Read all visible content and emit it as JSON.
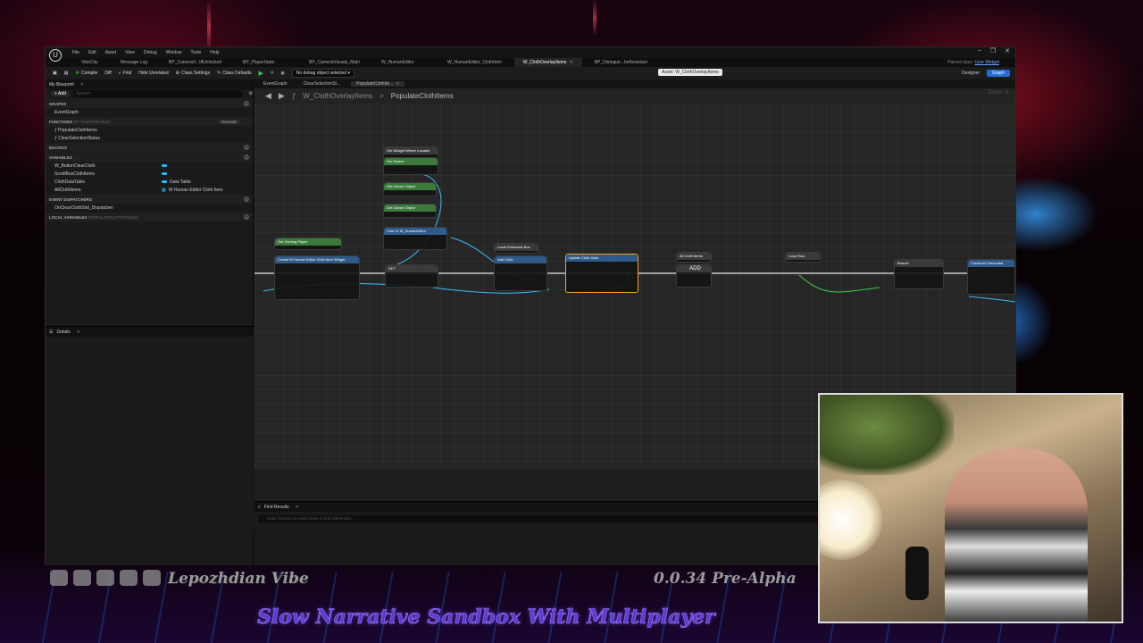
{
  "window": {
    "menu": [
      "File",
      "Edit",
      "Asset",
      "View",
      "Debug",
      "Window",
      "Tools",
      "Help"
    ],
    "controls": [
      "–",
      "❐",
      "✕"
    ],
    "project_tab": "VibeCity",
    "message_log": "Message Log",
    "tabs": [
      "BP_CameraV...tifUnlocked",
      "BP_PlayerState",
      "BP_CameraVisuals_Main",
      "W_HumanEditor",
      "W_HumanEditor_ClothItem",
      "W_ClothOverlayItems",
      "BP_Dialogue...beAssistant"
    ],
    "active_tab_index": 5,
    "parent_class_label": "Parent class:",
    "parent_class_value": "User Widget",
    "tooltip": "Asset: W_ClothOverlayItems"
  },
  "toolbar": {
    "compile": "Compile",
    "diff": "Diff",
    "find": "Find",
    "hide_unrelated": "Hide Unrelated",
    "class_settings": "Class Settings",
    "class_defaults": "Class Defaults",
    "debug_object": "No debug object selected",
    "designer": "Designer",
    "graph": "Graph"
  },
  "my_blueprint": {
    "title": "My Blueprint",
    "add": "+ Add",
    "search_placeholder": "Search",
    "sections": {
      "graphs": "GRAPHS",
      "functions": "FUNCTIONS",
      "functions_count": "(27 OVERRIDABLE)",
      "override": "Override",
      "macros": "MACROS",
      "variables": "VARIABLES",
      "event_dispatchers": "EVENT DISPATCHERS",
      "local_variables": "LOCAL VARIABLES",
      "local_variables_scope": "(POPULATECLOTHITEMS)"
    },
    "graphs": [
      "EventGraph"
    ],
    "functions": [
      "PopulateClothItems",
      "ClearSelectionStatus"
    ],
    "variables": [
      {
        "name": "W_ButtonClearCloth",
        "type": ""
      },
      {
        "name": "ScrollBoxClothItems",
        "type": ""
      },
      {
        "name": "ClothDataTable",
        "type": "Data Table"
      },
      {
        "name": "AllClothItems",
        "type": "W Human Editor Cloth Item"
      }
    ],
    "event_dispatchers": [
      "OnClearClothSlot_Dispatcher"
    ]
  },
  "details": {
    "title": "Details"
  },
  "graph": {
    "tabs": [
      "EventGraph",
      "ClearSelectionSt...",
      "PopulateClothIte..."
    ],
    "breadcrumb_root": "W_ClothOverlayItems",
    "breadcrumb_sep": ">",
    "breadcrumb_current": "PopulateClothItems",
    "zoom": "Zoom -3",
    "nodes": [
      {
        "id": "get-widgets",
        "title": "Get Widget Where Located",
        "color": "#3a3a3a"
      },
      {
        "id": "get-parent",
        "title": "Get Parent",
        "color": "#3c7a3c"
      },
      {
        "id": "get-owner-1",
        "title": "Get Owner Object",
        "color": "#3c7a3c"
      },
      {
        "id": "get-owner-2",
        "title": "Get Owner Object",
        "color": "#3c7a3c"
      },
      {
        "id": "cast",
        "title": "Cast To W_HumanEditor",
        "color": "#2f5b8a"
      },
      {
        "id": "get-owning-player",
        "title": "Get Owning Player",
        "color": "#3c7a3c"
      },
      {
        "id": "create-widget",
        "title": "Create W Human Editor Cloth Item Widget",
        "color": "#2f5b8a"
      },
      {
        "id": "set",
        "title": "SET",
        "color": "#3a3a3a"
      },
      {
        "id": "local-box",
        "title": "Local Horizontal Box",
        "color": "#3a3a3a"
      },
      {
        "id": "add-child",
        "title": "Add Child",
        "color": "#2f5b8a"
      },
      {
        "id": "update-cloth",
        "title": "Update Cloth Data",
        "color": "#2f5b8a"
      },
      {
        "id": "all-cloth",
        "title": "All Cloth Items",
        "color": "#3a3a3a"
      },
      {
        "id": "add",
        "title": "ADD",
        "color": "#3a3a3a"
      },
      {
        "id": "loop-row",
        "title": "Loop Row",
        "color": "#3a3a3a"
      },
      {
        "id": "branch",
        "title": "Branch",
        "color": "#3a3a3a"
      },
      {
        "id": "create-horizontal",
        "title": "Construct Horizontal",
        "color": "#2f5b8a"
      }
    ]
  },
  "find_results": {
    "title": "Find Results",
    "placeholder": "Enter function or event name to find references..."
  },
  "overlay": {
    "brand": "Lepozhdian Vibe",
    "version": "0.0.34 Pre-Alpha",
    "slogan": "Slow Narrative Sandbox With Multiplayer",
    "social_icons": [
      "youtube-icon",
      "twitch-icon",
      "steam-icon",
      "patreon-icon",
      "discord-icon"
    ]
  },
  "colors": {
    "accent_blue": "#1f6fd6",
    "play_green": "#3fc94a",
    "selected_node": "#f0a020",
    "slogan": "#5a3ad0"
  }
}
